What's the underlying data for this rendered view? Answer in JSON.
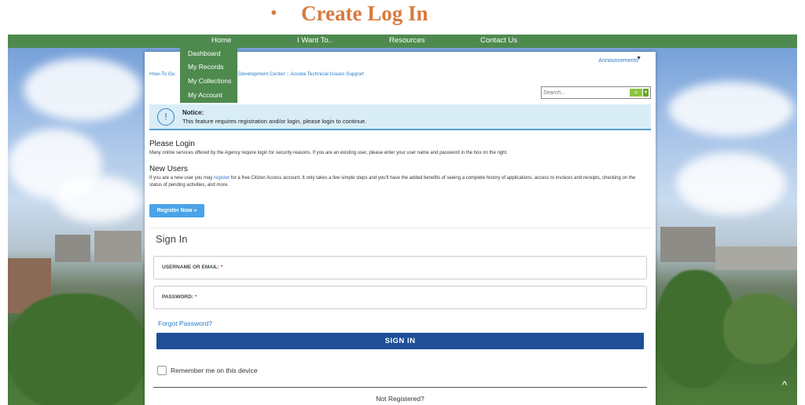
{
  "slide": {
    "bullet": "•",
    "title": "Create Log In"
  },
  "nav": {
    "items": [
      "Home",
      "I Want To..",
      "Resources",
      "Contact Us"
    ],
    "dropdown": [
      "Dashboard",
      "My Records",
      "My Collections",
      "My Account"
    ]
  },
  "header": {
    "announcements": "Announcements",
    "caret": "▼",
    "breadcrumb_left": "How-To Gu",
    "breadcrumb_right": "Development Center :: Accela Technical Issues Support"
  },
  "search": {
    "placeholder": "Search...",
    "icon": "⌕",
    "caret": "▾"
  },
  "notice": {
    "icon": "!",
    "title": "Notice:",
    "text": "This feature requires registration and/or login, please login to continue."
  },
  "login_info": {
    "heading": "Please Login",
    "text": "Many online services offered by the Agency require login for security reasons. If you are an existing user, please enter your user name and password in the box on the right."
  },
  "new_users": {
    "heading": "New Users",
    "text_before": "If you are a new user you may ",
    "link": "register",
    "text_after": " for a free Citizen Access account. It only takes a few simple steps and you'll have the added benefits of seeing a complete history of applications, access to invoices and receipts, checking on the status of pending activities, and more.",
    "register_button": "Register Now »"
  },
  "signin": {
    "title": "Sign In",
    "username_label": "USERNAME OR EMAIL:",
    "password_label": "PASSWORD:",
    "required_mark": "*",
    "username_value": "",
    "password_value": "",
    "forgot": "Forgot Password?",
    "button": "SIGN IN",
    "remember": "Remember me on this device",
    "not_registered": "Not Registered?"
  },
  "scroll_top_icon": "^",
  "colors": {
    "slide_title": "#d77a3f",
    "nav_green": "#4e8a4e",
    "signin_blue": "#1f4f96",
    "link_blue": "#2a7ac8"
  }
}
